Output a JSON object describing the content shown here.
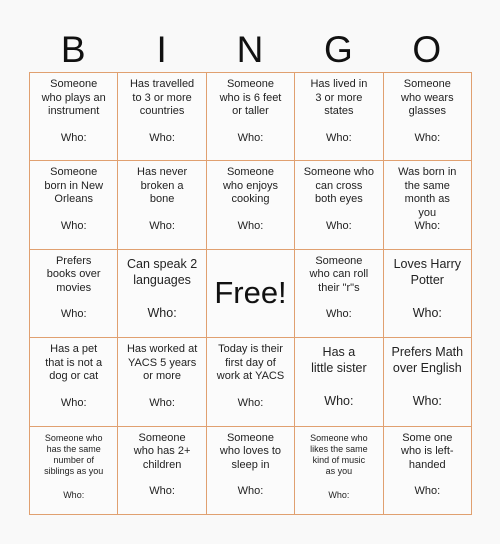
{
  "title_letters": [
    "B",
    "I",
    "N",
    "G",
    "O"
  ],
  "who_label": "Who:",
  "border_color": "#e0a070",
  "cells": [
    {
      "text": "Someone\nwho plays an\ninstrument",
      "who": "Who:"
    },
    {
      "text": "Has travelled\nto 3 or more\ncountries",
      "who": "Who:"
    },
    {
      "text": "Someone\nwho is 6 feet\nor taller",
      "who": "Who:"
    },
    {
      "text": "Has lived in\n3 or more\nstates",
      "who": "Who:"
    },
    {
      "text": "Someone\nwho wears\nglasses",
      "who": "Who:"
    },
    {
      "text": "Someone\nborn in New\nOrleans",
      "who": "Who:"
    },
    {
      "text": "Has never\nbroken a\nbone",
      "who": "Who:"
    },
    {
      "text": "Someone\nwho enjoys\ncooking",
      "who": "Who:"
    },
    {
      "text": "Someone who\ncan cross\nboth eyes",
      "who": "Who:"
    },
    {
      "text": "Was born in\nthe same\nmonth as\nyou",
      "who": "Who:"
    },
    {
      "text": "Prefers\nbooks over\nmovies",
      "who": "Who:"
    },
    {
      "text": "Can speak 2\nlanguages",
      "who": "Who:"
    },
    {
      "text": "Free!",
      "who": null
    },
    {
      "text": "Someone\nwho can roll\ntheir \"r\"s",
      "who": "Who:"
    },
    {
      "text": "Loves Harry\nPotter",
      "who": "Who:"
    },
    {
      "text": "Has a pet\nthat is not a\ndog or cat",
      "who": "Who:"
    },
    {
      "text": "Has worked at\nYACS 5 years\nor more",
      "who": "Who:"
    },
    {
      "text": "Today is their\nfirst day of\nwork at YACS",
      "who": "Who:"
    },
    {
      "text": "Has a\nlittle sister",
      "who": "Who:"
    },
    {
      "text": "Prefers Math\nover English",
      "who": "Who:"
    },
    {
      "text": "Someone who\nhas the same\nnumber of\nsiblings as you",
      "who": "Who:"
    },
    {
      "text": "Someone\nwho has 2+\nchildren",
      "who": "Who:"
    },
    {
      "text": "Someone\nwho loves to\nsleep in",
      "who": "Who:"
    },
    {
      "text": "Someone who\nlikes the same\nkind of music\nas you",
      "who": "Who:"
    },
    {
      "text": "Some one\nwho is left-\nhanded",
      "who": "Who:"
    }
  ]
}
